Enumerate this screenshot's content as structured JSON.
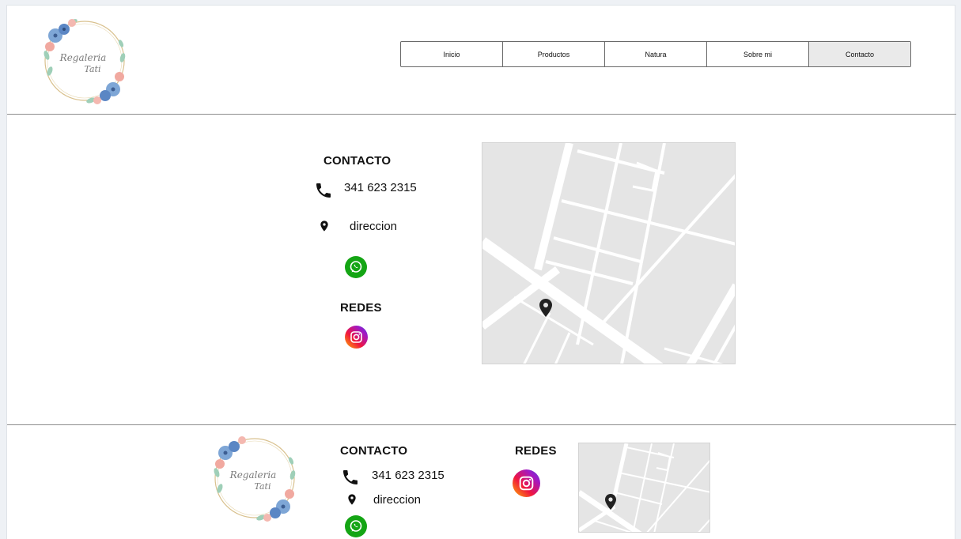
{
  "brand": {
    "logo_text_line1": "Regaleria",
    "logo_text_line2": "Tati"
  },
  "nav": {
    "items": [
      {
        "label": "Inicio"
      },
      {
        "label": "Productos"
      },
      {
        "label": "Natura"
      },
      {
        "label": "Sobre mi"
      },
      {
        "label": "Contacto",
        "active": true
      }
    ]
  },
  "contact": {
    "heading": "CONTACTO",
    "phone": "341 623 2315",
    "address": "direccion",
    "networks_heading": "REDES"
  },
  "footer": {
    "contact_heading": "CONTACTO",
    "phone": "341 623 2315",
    "address": "direccion",
    "networks_heading": "REDES"
  },
  "colors": {
    "whatsapp": "#14a514",
    "map_bg": "#e5e5e5",
    "separator": "#8c8c8c",
    "active_tab": "#eaeaea"
  },
  "icons": [
    "phone-icon",
    "location-pin-icon",
    "whatsapp-icon",
    "instagram-icon",
    "map-marker-icon"
  ]
}
